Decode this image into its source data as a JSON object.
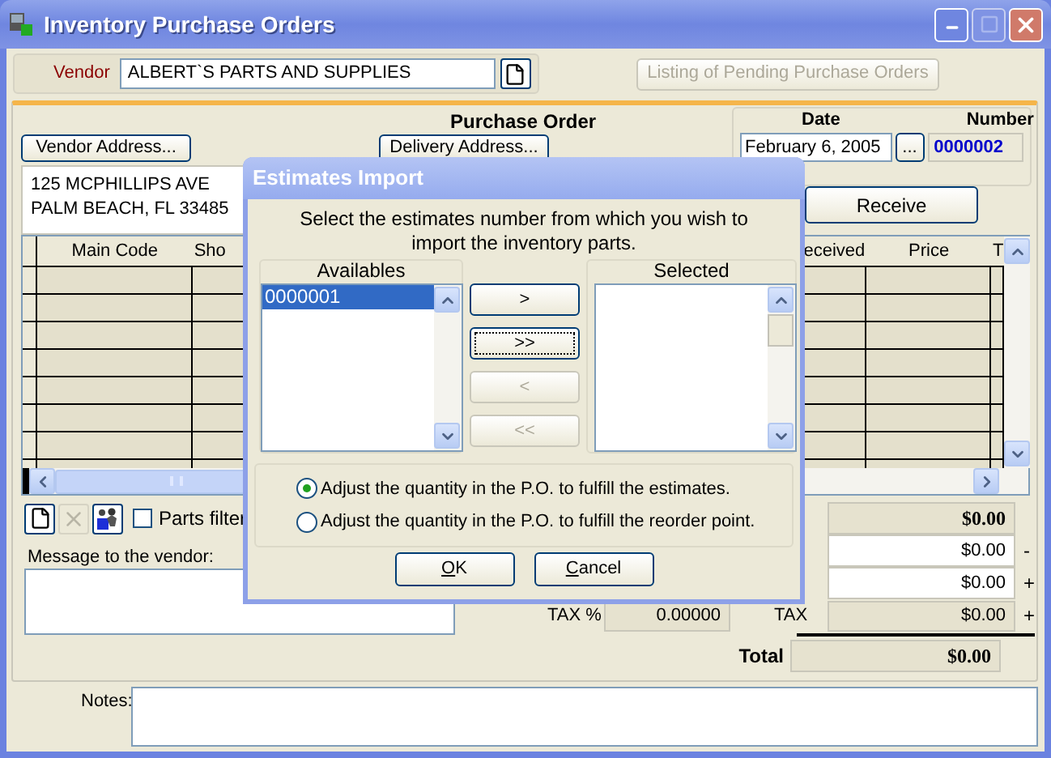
{
  "window": {
    "title": "Inventory Purchase Orders"
  },
  "vendor": {
    "label": "Vendor",
    "value": "ALBERT`S PARTS AND SUPPLIES"
  },
  "pending_button": {
    "label": "Listing of Pending Purchase Orders",
    "disabled": true
  },
  "purchase_order": {
    "title": "Purchase Order",
    "date_label": "Date",
    "date_value": "February 6, 2005",
    "date_button": "...",
    "number_label": "Number",
    "number_value": "0000002"
  },
  "vendor_address_button": "Vendor Address...",
  "delivery_address_button": "Delivery Address...",
  "address_lines": [
    "125 MCPHILLIPS AVE",
    "PALM BEACH, FL 33485"
  ],
  "receive_button": "Receive",
  "table": {
    "columns": [
      "Main Code",
      "Sho",
      "eceived",
      "Price",
      "T"
    ]
  },
  "tools": [
    {
      "kind": "new",
      "disabled": false
    },
    {
      "kind": "delete",
      "disabled": true
    },
    {
      "kind": "people",
      "disabled": false
    }
  ],
  "parts_filter": {
    "label": "Parts filter",
    "checked": false
  },
  "message_label": "Message to the vendor:",
  "totals": [
    {
      "kind": "sum",
      "value": "$0.00"
    },
    {
      "kind": "input",
      "value": "$0.00",
      "sign": "-"
    },
    {
      "kind": "input",
      "value": "$0.00",
      "sign": "+"
    }
  ],
  "tax": {
    "percent_label": "TAX %",
    "percent_value": "0.00000",
    "label": "TAX",
    "value": "$0.00",
    "sign": "+"
  },
  "total": {
    "label": "Total",
    "value": "$0.00"
  },
  "notes_label": "Notes:",
  "dialog": {
    "title": "Estimates Import",
    "instructions": "Select the estimates number from which you wish to import the inventory parts.",
    "available": {
      "label": "Availables",
      "items": [
        {
          "text": "0000001",
          "selected": true
        }
      ]
    },
    "chosen": {
      "label": "Selected"
    },
    "move_buttons": [
      {
        "label": ">",
        "disabled": false,
        "focused": false
      },
      {
        "label": ">>",
        "disabled": false,
        "focused": true
      },
      {
        "label": "<",
        "disabled": true,
        "focused": false
      },
      {
        "label": "<<",
        "disabled": true,
        "focused": false
      }
    ],
    "options": [
      {
        "label": "Adjust the quantity in the P.O. to fulfill the estimates.",
        "selected": true
      },
      {
        "label": "Adjust the quantity in the P.O. to fulfill the reorder point.",
        "selected": false
      }
    ],
    "buttons": [
      {
        "label": "OK",
        "accelerator": true
      },
      {
        "label": "Cancel",
        "accelerator": true
      }
    ]
  }
}
